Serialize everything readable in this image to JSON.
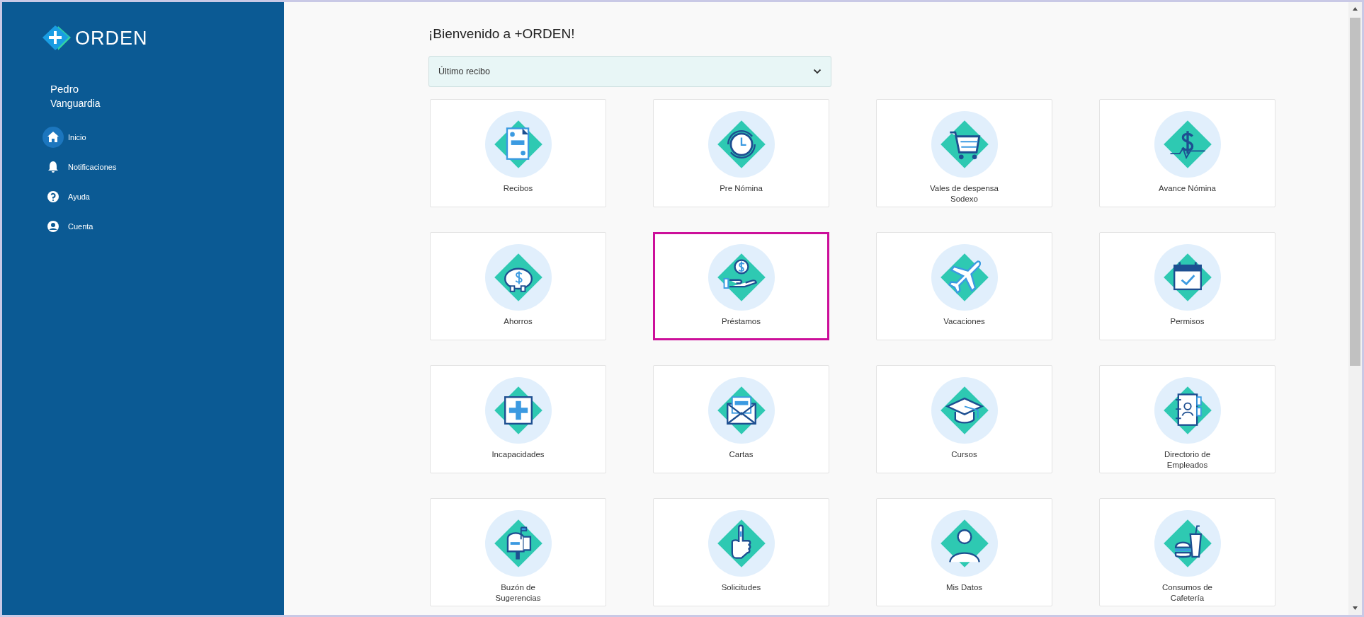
{
  "sidebar": {
    "logo_text": "ORDEN",
    "user_first_name": "Pedro",
    "user_last_name": "Vanguardia",
    "nav": [
      {
        "label": "Inicio",
        "selected": true
      },
      {
        "label": "Notificaciones",
        "selected": false
      },
      {
        "label": "Ayuda",
        "selected": false
      },
      {
        "label": "Cuenta",
        "selected": false
      }
    ]
  },
  "welcome_title": "¡Bienvenido a +ORDEN!",
  "receipt_dropdown": {
    "label": "Último recibo"
  },
  "tiles": [
    {
      "label": "Recibos",
      "selected": false
    },
    {
      "label": "Pre Nómina",
      "selected": false
    },
    {
      "label": "Vales de despensa Sodexo",
      "selected": false
    },
    {
      "label": "Avance Nómina",
      "selected": false
    },
    {
      "label": "Ahorros",
      "selected": false
    },
    {
      "label": "Préstamos",
      "selected": true
    },
    {
      "label": "Vacaciones",
      "selected": false
    },
    {
      "label": "Permisos",
      "selected": false
    },
    {
      "label": "Incapacidades",
      "selected": false
    },
    {
      "label": "Cartas",
      "selected": false
    },
    {
      "label": "Cursos",
      "selected": false
    },
    {
      "label": "Directorio de Empleados",
      "selected": false
    },
    {
      "label": "Buzón de Sugerencias",
      "selected": false
    },
    {
      "label": "Solicitudes",
      "selected": false
    },
    {
      "label": "Mis Datos",
      "selected": false
    },
    {
      "label": "Consumos de Cafetería",
      "selected": false
    }
  ]
}
